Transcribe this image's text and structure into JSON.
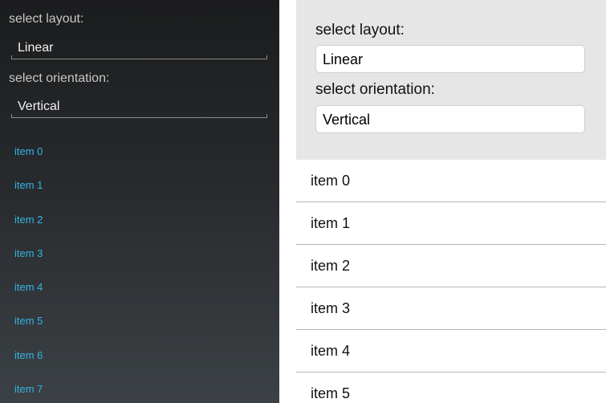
{
  "android": {
    "layout_label": "select layout:",
    "layout_value": "Linear",
    "orientation_label": "select orientation:",
    "orientation_value": "Vertical",
    "items": [
      "item 0",
      "item 1",
      "item 2",
      "item 3",
      "item 4",
      "item 5",
      "item 6",
      "item 7"
    ],
    "colors": {
      "item_text": "#33b5e5",
      "background_top": "#1b1c1d",
      "background_bottom": "#3c4145"
    }
  },
  "ios": {
    "layout_label": "select layout:",
    "layout_value": "Linear",
    "orientation_label": "select orientation:",
    "orientation_value": "Vertical",
    "items": [
      "item 0",
      "item 1",
      "item 2",
      "item 3",
      "item 4",
      "item 5"
    ],
    "colors": {
      "header_background": "#e6e6e6",
      "separator": "#b5b5b5"
    }
  }
}
